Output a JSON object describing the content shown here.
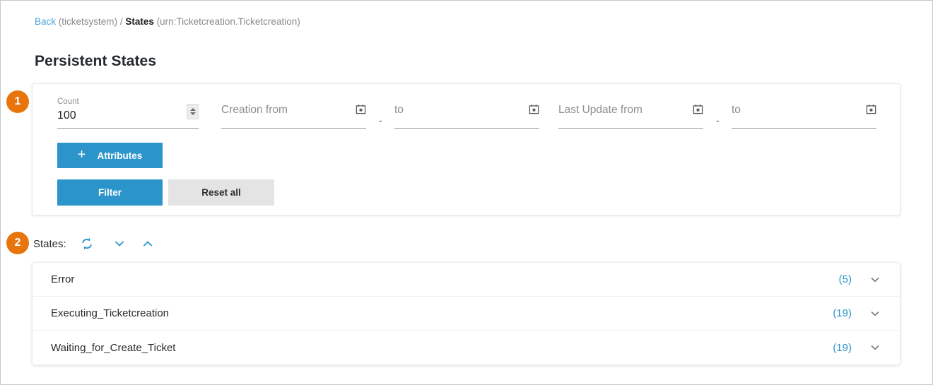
{
  "breadcrumb": {
    "back_label": "Back",
    "back_context": "(ticketsystem)",
    "separator": "/",
    "current_label": "States",
    "current_context": "(urn:Ticketcreation.Ticketcreation)"
  },
  "page": {
    "title": "Persistent States"
  },
  "steps": {
    "one": "1",
    "two": "2"
  },
  "filter": {
    "count": {
      "label": "Count",
      "value": "100",
      "spinner_icon": "spinner-updown-icon"
    },
    "creation_from": {
      "placeholder": "Creation from",
      "value": "",
      "icon": "calendar-icon"
    },
    "creation_to": {
      "placeholder": "to",
      "value": "",
      "icon": "calendar-icon"
    },
    "last_update_from": {
      "placeholder": "Last Update from",
      "value": "",
      "icon": "calendar-icon"
    },
    "last_update_to": {
      "placeholder": "to",
      "value": "",
      "icon": "calendar-icon"
    },
    "range_dash": "-",
    "attributes_label": "Attributes",
    "attributes_plus": "+",
    "filter_label": "Filter",
    "reset_label": "Reset all"
  },
  "states": {
    "label": "States:",
    "refresh_icon": "refresh-icon",
    "expand_all_icon": "chevron-down-icon",
    "collapse_all_icon": "chevron-up-icon",
    "rows": [
      {
        "name": "Error",
        "count": "(5)",
        "chevron": "chevron-down-icon"
      },
      {
        "name": "Executing_Ticketcreation",
        "count": "(19)",
        "chevron": "chevron-down-icon"
      },
      {
        "name": "Waiting_for_Create_Ticket",
        "count": "(19)",
        "chevron": "chevron-down-icon"
      }
    ]
  },
  "colors": {
    "accent_blue": "#2b95cb",
    "link_blue": "#4aa3d8",
    "badge_orange": "#e8740c",
    "button_gray": "#e4e4e4"
  }
}
